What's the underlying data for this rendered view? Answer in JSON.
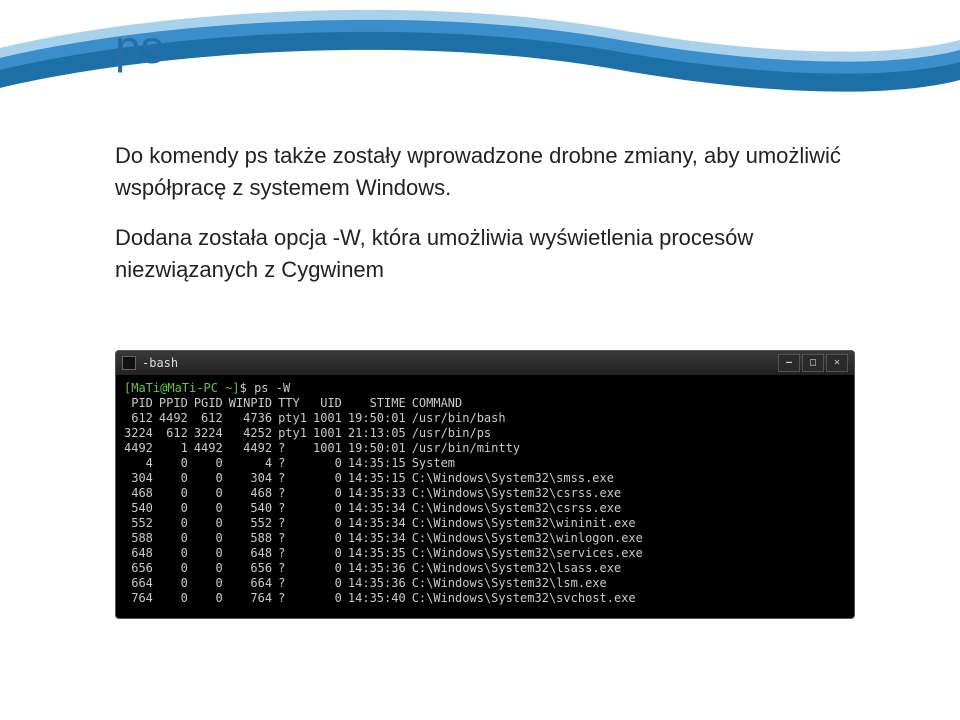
{
  "slide": {
    "title": "ps",
    "paragraphs": [
      "Do komendy ps także zostały wprowadzone drobne zmiany, aby umożliwić współpracę z systemem Windows.",
      "Dodana została opcja -W, która umożliwia wyświetlenia procesów niezwiązanych z Cygwinem"
    ]
  },
  "terminal": {
    "window_title": "-bash",
    "prompt_user": "[MaTi@MaTi-PC ~]",
    "prompt_sep": "$",
    "command": "ps -W",
    "headers": [
      "PID",
      "PPID",
      "PGID",
      "WINPID",
      "TTY",
      "UID",
      "STIME",
      "COMMAND"
    ],
    "rows": [
      {
        "pid": "612",
        "ppid": "4492",
        "pgid": "612",
        "winpid": "4736",
        "tty": "pty1",
        "uid": "1001",
        "stime": "19:50:01",
        "command": "/usr/bin/bash"
      },
      {
        "pid": "3224",
        "ppid": "612",
        "pgid": "3224",
        "winpid": "4252",
        "tty": "pty1",
        "uid": "1001",
        "stime": "21:13:05",
        "command": "/usr/bin/ps"
      },
      {
        "pid": "4492",
        "ppid": "1",
        "pgid": "4492",
        "winpid": "4492",
        "tty": "?",
        "uid": "1001",
        "stime": "19:50:01",
        "command": "/usr/bin/mintty"
      },
      {
        "pid": "4",
        "ppid": "0",
        "pgid": "0",
        "winpid": "4",
        "tty": "?",
        "uid": "0",
        "stime": "14:35:15",
        "command": "System"
      },
      {
        "pid": "304",
        "ppid": "0",
        "pgid": "0",
        "winpid": "304",
        "tty": "?",
        "uid": "0",
        "stime": "14:35:15",
        "command": "C:\\Windows\\System32\\smss.exe"
      },
      {
        "pid": "468",
        "ppid": "0",
        "pgid": "0",
        "winpid": "468",
        "tty": "?",
        "uid": "0",
        "stime": "14:35:33",
        "command": "C:\\Windows\\System32\\csrss.exe"
      },
      {
        "pid": "540",
        "ppid": "0",
        "pgid": "0",
        "winpid": "540",
        "tty": "?",
        "uid": "0",
        "stime": "14:35:34",
        "command": "C:\\Windows\\System32\\csrss.exe"
      },
      {
        "pid": "552",
        "ppid": "0",
        "pgid": "0",
        "winpid": "552",
        "tty": "?",
        "uid": "0",
        "stime": "14:35:34",
        "command": "C:\\Windows\\System32\\wininit.exe"
      },
      {
        "pid": "588",
        "ppid": "0",
        "pgid": "0",
        "winpid": "588",
        "tty": "?",
        "uid": "0",
        "stime": "14:35:34",
        "command": "C:\\Windows\\System32\\winlogon.exe"
      },
      {
        "pid": "648",
        "ppid": "0",
        "pgid": "0",
        "winpid": "648",
        "tty": "?",
        "uid": "0",
        "stime": "14:35:35",
        "command": "C:\\Windows\\System32\\services.exe"
      },
      {
        "pid": "656",
        "ppid": "0",
        "pgid": "0",
        "winpid": "656",
        "tty": "?",
        "uid": "0",
        "stime": "14:35:36",
        "command": "C:\\Windows\\System32\\lsass.exe"
      },
      {
        "pid": "664",
        "ppid": "0",
        "pgid": "0",
        "winpid": "664",
        "tty": "?",
        "uid": "0",
        "stime": "14:35:36",
        "command": "C:\\Windows\\System32\\lsm.exe"
      },
      {
        "pid": "764",
        "ppid": "0",
        "pgid": "0",
        "winpid": "764",
        "tty": "?",
        "uid": "0",
        "stime": "14:35:40",
        "command": "C:\\Windows\\System32\\svchost.exe"
      }
    ]
  },
  "icons": {
    "minimize": "—",
    "maximize": "□",
    "close": "✕"
  }
}
